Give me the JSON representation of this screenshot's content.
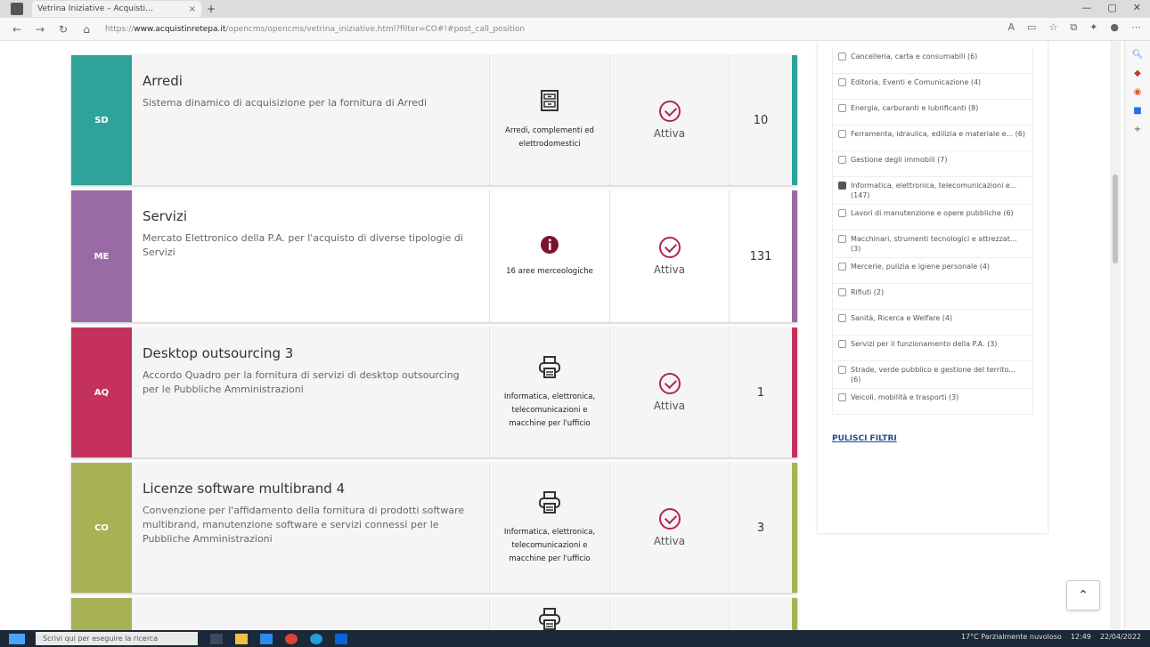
{
  "browser": {
    "tab_title": "Vetrina Iniziative – Acquisti…",
    "tab_close": "×",
    "new_tab": "+",
    "url_prefix": "https://",
    "url_host": "www.acquistinretepa.it",
    "url_path": "/opencms/opencms/vetrina_iniziative.html?filter=CO#!#post_call_position",
    "win_min": "—",
    "win_max": "▢",
    "win_close": "✕",
    "back": "←",
    "forward": "→",
    "refresh": "↻",
    "home": "⌂"
  },
  "cards": [
    {
      "badge": "SD",
      "badge_color": "#2fa39a",
      "accent": "#2fa39a",
      "title": "Arredi",
      "description": "Sistema dinamico di acquisizione per la fornitura di Arredi",
      "category": "Arredi, complementi ed elettrodomestici",
      "category_icon": "cabinet-icon",
      "status": "Attiva",
      "count": "10"
    },
    {
      "badge": "ME",
      "badge_color": "#9a6aa6",
      "accent": "#9a6aa6",
      "title": "Servizi",
      "description": "Mercato Elettronico della P.A. per l'acquisto di diverse tipologie di Servizi",
      "category": "16 aree merceologiche",
      "category_icon": "info-icon",
      "status": "Attiva",
      "count": "131"
    },
    {
      "badge": "AQ",
      "badge_color": "#c5315d",
      "accent": "#c5315d",
      "title": "Desktop outsourcing 3",
      "description": "Accordo Quadro per la fornitura di servizi di desktop outsourcing per le Pubbliche Amministrazioni",
      "category": "Informatica, elettronica, telecomunicazioni e macchine per l'ufficio",
      "category_icon": "printer-icon",
      "status": "Attiva",
      "count": "1"
    },
    {
      "badge": "CO",
      "badge_color": "#a8b254",
      "accent": "#a8b254",
      "title": "Licenze software multibrand 4",
      "description": "Convenzione per l'affidamento della fornitura di prodotti software multibrand, manutenzione software e servizi connessi per le Pubbliche Amministrazioni",
      "category": "Informatica, elettronica, telecomunicazioni e macchine per l'ufficio",
      "category_icon": "printer-icon",
      "status": "Attiva",
      "count": "3"
    },
    {
      "badge": "",
      "badge_color": "#a8b254",
      "accent": "#a8b254",
      "title": "",
      "description": "",
      "category": "",
      "category_icon": "printer-icon",
      "status": "",
      "count": ""
    }
  ],
  "filter": {
    "items": [
      {
        "label": "Cancelleria, carta e consumabili (6)",
        "checked": false
      },
      {
        "label": "Editoria, Eventi e Comunicazione (4)",
        "checked": false
      },
      {
        "label": "Energia, carburanti e lubrificanti (8)",
        "checked": false
      },
      {
        "label": "Ferramenta, idraulica, edilizia e materiale e... (6)",
        "checked": false
      },
      {
        "label": "Gestione degli immobili (7)",
        "checked": false
      },
      {
        "label": "Informatica, elettronica, telecomunicazioni e... (147)",
        "checked": true
      },
      {
        "label": "Lavori di manutenzione e opere pubbliche (6)",
        "checked": false
      },
      {
        "label": "Macchinari, strumenti tecnologici e attrezzat... (3)",
        "checked": false
      },
      {
        "label": "Mercerie, pulizia e igiene personale (4)",
        "checked": false
      },
      {
        "label": "Rifiuti (2)",
        "checked": false
      },
      {
        "label": "Sanità, Ricerca e Welfare (4)",
        "checked": false
      },
      {
        "label": "Servizi per il funzionamento della P.A. (3)",
        "checked": false
      },
      {
        "label": "Strade, verde pubblico e gestione del territo... (6)",
        "checked": false
      },
      {
        "label": "Veicoli, mobilità e trasporti (3)",
        "checked": false
      }
    ],
    "reset_label": "PULISCI FILTRI"
  },
  "back_to_top": "⌃",
  "taskbar": {
    "search_placeholder": "Scrivi qui per eseguire la ricerca",
    "tray_text": "17°C Parzialmente nuvoloso",
    "time": "12:49",
    "date": "22/04/2022"
  }
}
